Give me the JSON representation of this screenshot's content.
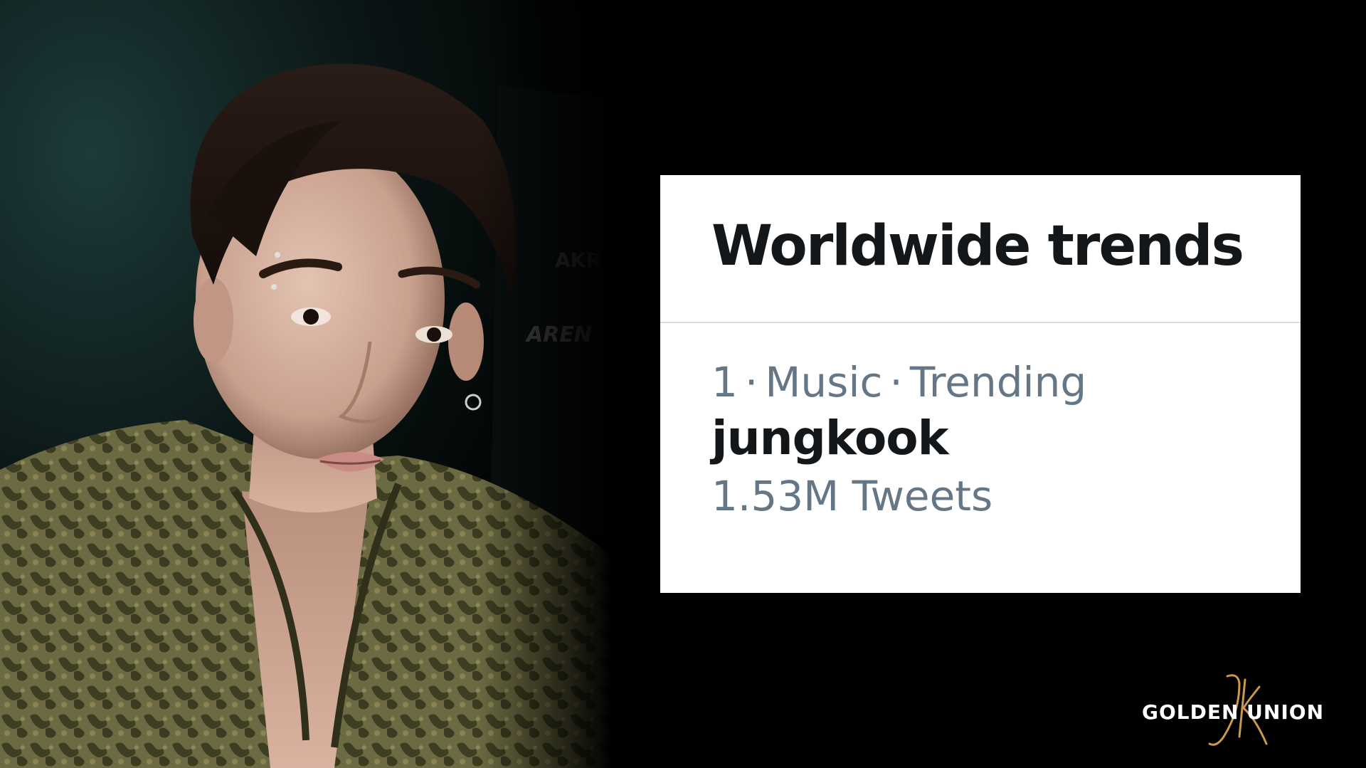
{
  "card": {
    "title": "Worldwide trends",
    "trend": {
      "rank": "1",
      "category": "Music",
      "status": "Trending",
      "separator": "·",
      "name": "jungkook",
      "count": "1.53M Tweets"
    }
  },
  "watermark": {
    "text": "GOLDEN UNION",
    "monogram": "JK"
  },
  "colors": {
    "background": "#000000",
    "card": "#ffffff",
    "title": "#14171a",
    "meta": "#657786",
    "divider": "#d9dde1",
    "monogram": "#c9974e"
  },
  "photo": {
    "description_icon": "person-photo"
  }
}
